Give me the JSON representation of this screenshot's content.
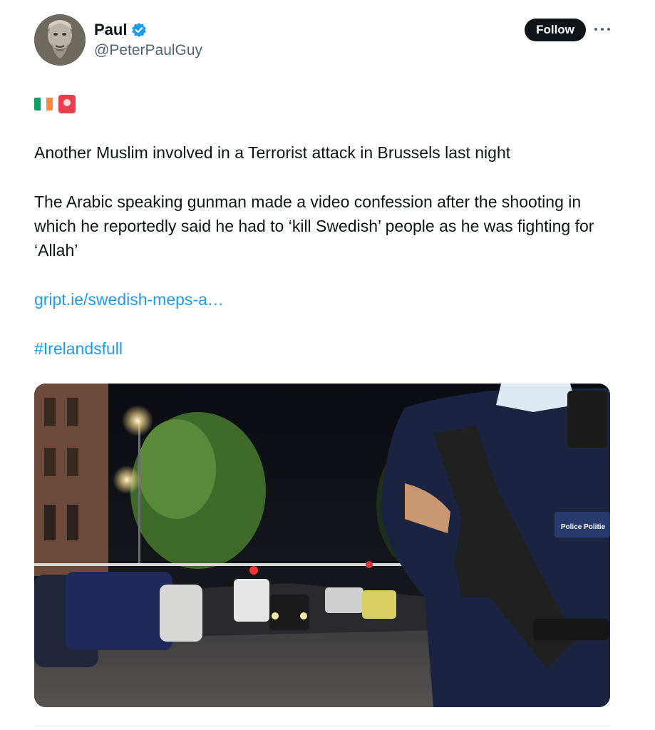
{
  "author": {
    "display_name": "Paul",
    "handle": "@PeterPaulGuy",
    "verified": true
  },
  "actions": {
    "follow_label": "Follow",
    "more_icon": "more-horizontal-icon"
  },
  "emojis": [
    "ireland-flag-icon",
    "police-siren-icon"
  ],
  "text": {
    "line_1": "Another Muslim involved in a Terrorist attack in Brussels last night",
    "line_2": "The Arabic speaking  gunman made a video confession after the shooting in which he reportedly said he had to ‘kill Swedish’ people as he was fighting for ‘Allah’"
  },
  "link": {
    "url_text": "gript.ie/swedish-meps-a…",
    "hashtag": "#Irelandsfull"
  },
  "media": {
    "badge_text": "Police Politie"
  },
  "colors": {
    "accent": "#1d9bf0",
    "text": "#0f1419",
    "secondary": "#536471",
    "follow_bg": "#0f1419"
  }
}
